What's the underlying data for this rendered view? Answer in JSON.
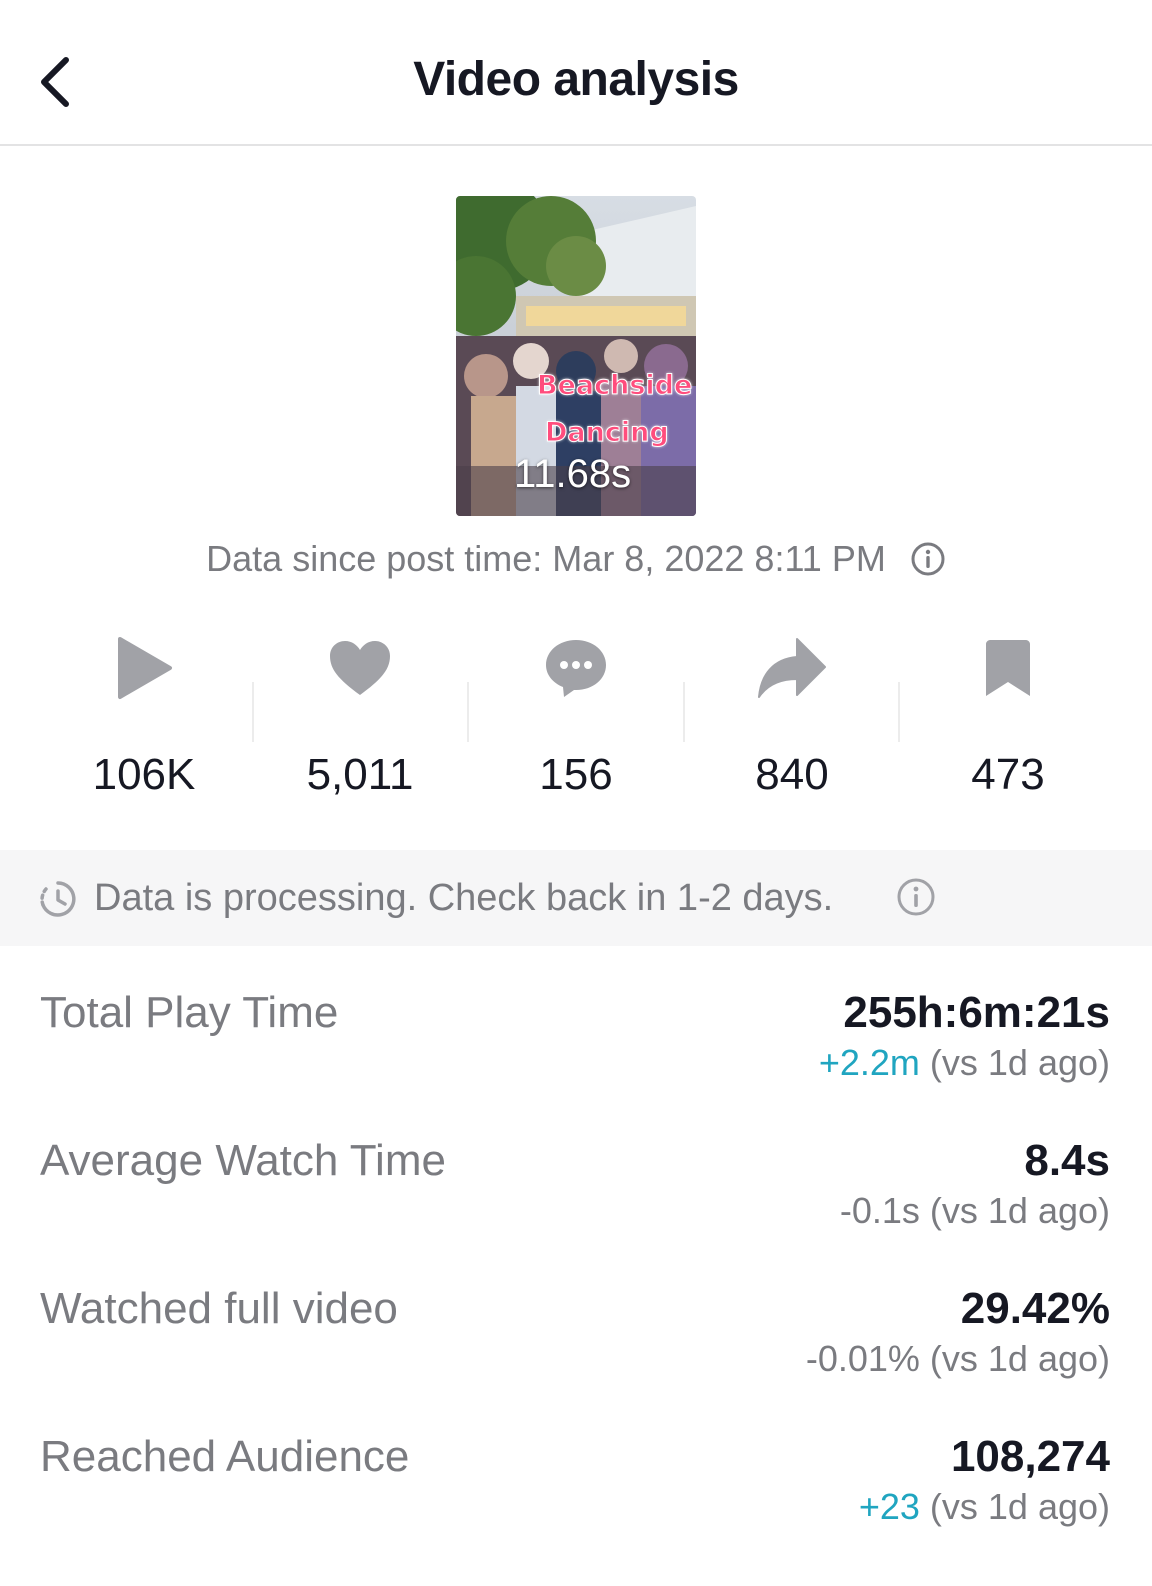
{
  "header": {
    "title": "Video analysis",
    "back_icon": "chevron-left-icon"
  },
  "video": {
    "overlay_line1": "Beachside",
    "overlay_line2": "Dancing",
    "duration": "11.68s"
  },
  "post_time": {
    "text": "Data since post time: Mar 8, 2022 8:11 PM",
    "icon": "info-icon"
  },
  "stats": [
    {
      "icon": "play-icon",
      "value": "106K"
    },
    {
      "icon": "heart-icon",
      "value": "5,011"
    },
    {
      "icon": "comment-icon",
      "value": "156"
    },
    {
      "icon": "share-icon",
      "value": "840"
    },
    {
      "icon": "bookmark-icon",
      "value": "473"
    }
  ],
  "notice": {
    "icon": "clock-icon",
    "text": "Data is processing. Check back in 1-2 days.",
    "info_icon": "info-icon"
  },
  "metrics": [
    {
      "label": "Total Play Time",
      "value": "255h:6m:21s",
      "delta": "+2.2m",
      "delta_suffix": " (vs 1d ago)"
    },
    {
      "label": "Average Watch Time",
      "value": "8.4s",
      "delta": "-0.1s",
      "delta_suffix": " (vs 1d ago)"
    },
    {
      "label": "Watched full video",
      "value": "29.42%",
      "delta": "-0.01%",
      "delta_suffix": " (vs 1d ago)"
    },
    {
      "label": "Reached Audience",
      "value": "108,274",
      "delta": "+23",
      "delta_suffix": " (vs 1d ago)"
    }
  ],
  "colors": {
    "positive_delta": "#20a5c0",
    "secondary_text": "#7a7b80",
    "icon_gray": "#a1a2a7"
  }
}
